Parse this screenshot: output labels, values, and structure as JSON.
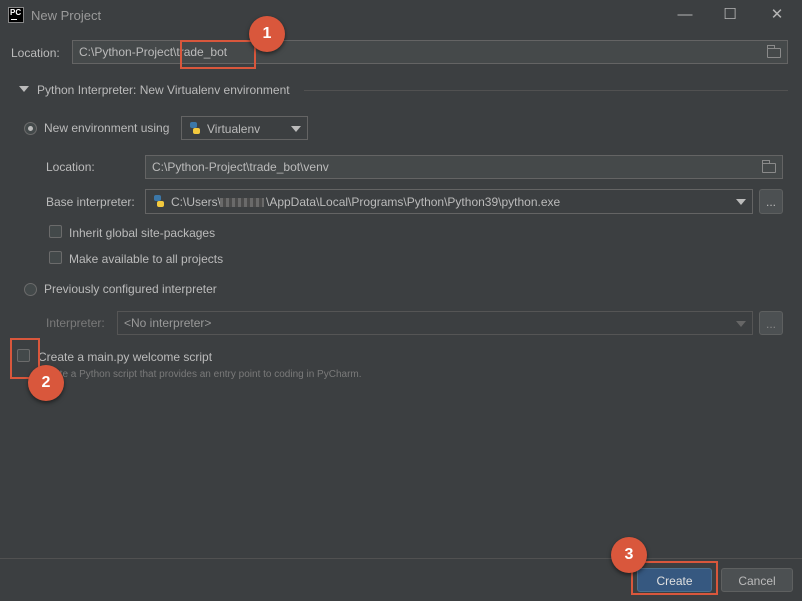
{
  "window": {
    "title": "New Project",
    "logo_text": "PC",
    "minimize": "—",
    "maximize": "☐",
    "close": "✕"
  },
  "project": {
    "location_label": "Location:",
    "location_value": "C:\\Python-Project\\trade_bot"
  },
  "interpreter_section": {
    "header": "Python Interpreter: New Virtualenv environment",
    "new_env_label": "New environment using",
    "env_tool": "Virtualenv",
    "location_label": "Location:",
    "location_value": "C:\\Python-Project\\trade_bot\\venv",
    "base_label": "Base interpreter:",
    "base_value_prefix": "C:\\Users\\",
    "base_value_suffix": "\\AppData\\Local\\Programs\\Python\\Python39\\python.exe",
    "browse": "...",
    "inherit_label": "Inherit global site-packages",
    "available_label": "Make available to all projects",
    "prev_label": "Previously configured interpreter",
    "interp_label": "Interpreter:",
    "interp_value": "<No interpreter>"
  },
  "welcome": {
    "label": "Create a main.py welcome script",
    "desc": "Create a Python script that provides an entry point to coding in PyCharm."
  },
  "buttons": {
    "create": "Create",
    "cancel": "Cancel"
  },
  "annotations": [
    "1",
    "2",
    "3"
  ],
  "colors": {
    "background": "#3c3f41",
    "callout": "#d9573c",
    "primary_button": "#365880"
  }
}
